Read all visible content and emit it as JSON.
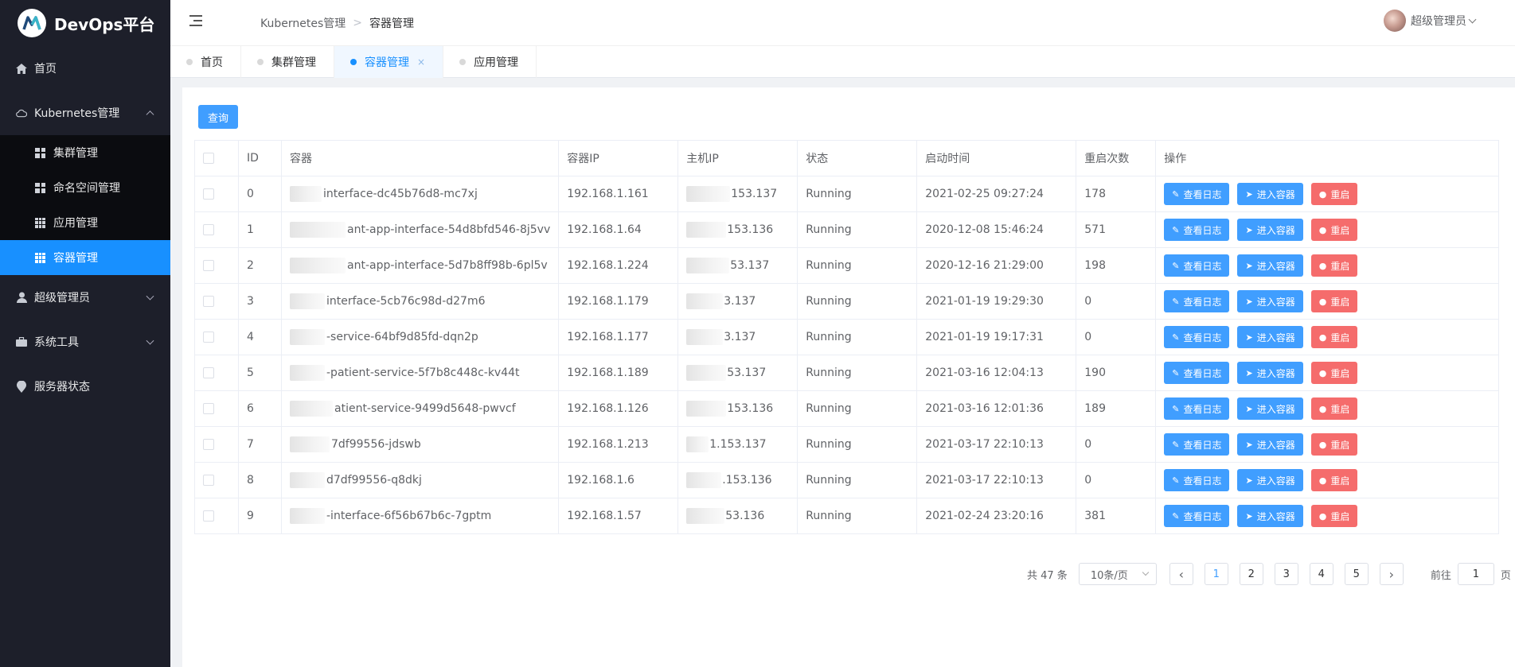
{
  "brand": {
    "title": "DevOps平台"
  },
  "sidebar": {
    "home": "首页",
    "kubernetes": "Kubernetes管理",
    "k8s_items": [
      "集群管理",
      "命名空间管理",
      "应用管理",
      "容器管理"
    ],
    "super_admin": "超级管理员",
    "system_tools": "系统工具",
    "server_status": "服务器状态"
  },
  "header": {
    "breadcrumb": [
      "Kubernetes管理",
      "容器管理"
    ],
    "user_name": "超级管理员"
  },
  "tags": [
    "首页",
    "集群管理",
    "容器管理",
    "应用管理"
  ],
  "active_tag_close": "×",
  "toolbar": {
    "query_label": "查询"
  },
  "table": {
    "headers": [
      "ID",
      "容器",
      "容器IP",
      "主机IP",
      "状态",
      "启动时间",
      "重启次数",
      "操作"
    ],
    "rows": [
      {
        "id": "0",
        "container": "interface-dc45b76d8-mc7xj",
        "container_ip": "192.168.1.161",
        "host_ip": "153.137",
        "status": "Running",
        "start_time": "2021-02-25 09:27:24",
        "restarts": "178"
      },
      {
        "id": "1",
        "container": "ant-app-interface-54d8bfd546-8j5vv",
        "container_ip": "192.168.1.64",
        "host_ip": "153.136",
        "status": "Running",
        "start_time": "2020-12-08 15:46:24",
        "restarts": "571"
      },
      {
        "id": "2",
        "container": "ant-app-interface-5d7b8ff98b-6pl5v",
        "container_ip": "192.168.1.224",
        "host_ip": "53.137",
        "status": "Running",
        "start_time": "2020-12-16 21:29:00",
        "restarts": "198"
      },
      {
        "id": "3",
        "container": "interface-5cb76c98d-d27m6",
        "container_ip": "192.168.1.179",
        "host_ip": "3.137",
        "status": "Running",
        "start_time": "2021-01-19 19:29:30",
        "restarts": "0"
      },
      {
        "id": "4",
        "container": "-service-64bf9d85fd-dqn2p",
        "container_ip": "192.168.1.177",
        "host_ip": "3.137",
        "status": "Running",
        "start_time": "2021-01-19 19:17:31",
        "restarts": "0"
      },
      {
        "id": "5",
        "container": "-patient-service-5f7b8c448c-kv44t",
        "container_ip": "192.168.1.189",
        "host_ip": "53.137",
        "status": "Running",
        "start_time": "2021-03-16 12:04:13",
        "restarts": "190"
      },
      {
        "id": "6",
        "container": "atient-service-9499d5648-pwvcf",
        "container_ip": "192.168.1.126",
        "host_ip": "153.136",
        "status": "Running",
        "start_time": "2021-03-16 12:01:36",
        "restarts": "189"
      },
      {
        "id": "7",
        "container": "7df99556-jdswb",
        "container_ip": "192.168.1.213",
        "host_ip": "1.153.137",
        "status": "Running",
        "start_time": "2021-03-17 22:10:13",
        "restarts": "0"
      },
      {
        "id": "8",
        "container": "d7df99556-q8dkj",
        "container_ip": "192.168.1.6",
        "host_ip": ".153.136",
        "status": "Running",
        "start_time": "2021-03-17 22:10:13",
        "restarts": "0"
      },
      {
        "id": "9",
        "container": "-interface-6f56b67b6c-7gptm",
        "container_ip": "192.168.1.57",
        "host_ip": "53.136",
        "status": "Running",
        "start_time": "2021-02-24 23:20:16",
        "restarts": "381"
      }
    ],
    "actions": {
      "logs": "查看日志",
      "enter": "进入容器",
      "restart": "重启"
    }
  },
  "pagination": {
    "total": "共 47 条",
    "page_size": "10条/页",
    "pages": [
      "1",
      "2",
      "3",
      "4",
      "5"
    ],
    "current": "1",
    "goto_prefix": "前往",
    "goto_value": "1",
    "goto_suffix": "页"
  },
  "colors": {
    "primary": "#409eff",
    "danger": "#f56c6c",
    "sidebar_bg": "#1d1f2a",
    "sidebar_active": "#1890ff"
  }
}
